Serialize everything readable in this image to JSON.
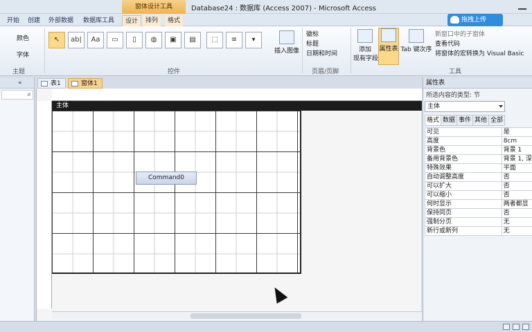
{
  "title": {
    "context_header": "窗体设计工具",
    "window_title": "Database24 : 数据库 (Access 2007) - Microsoft Access"
  },
  "tabs": {
    "items": [
      "开始",
      "创建",
      "外部数据",
      "数据库工具",
      "设计",
      "排列",
      "格式"
    ],
    "active": "设计"
  },
  "cloud_button": {
    "label": "拖拽上传"
  },
  "ribbon": {
    "left_labels": {
      "themes": "主题",
      "colors": "颜色",
      "fonts": "字体"
    },
    "controls_group_label": "控件",
    "header_footer": {
      "logo": "徽标",
      "title": "标题",
      "datetime": "日期和时间",
      "group_label": "页眉/页脚"
    },
    "insert_image": "插入图像",
    "tools": {
      "add_fields": "添加\n现有字段",
      "property_sheet": "属性表",
      "tab_order": "Tab 键次序",
      "subform": "新窗口中的子窗体",
      "view_code": "查看代码",
      "convert_macros": "将窗体的宏转换为 Visual Basic",
      "group_label": "工具"
    }
  },
  "nav": {
    "search_icon": "search-icon"
  },
  "doc_tabs": [
    {
      "label": "表1",
      "active": false
    },
    {
      "label": "窗体1",
      "active": true
    }
  ],
  "design": {
    "section_label": "主体",
    "button_label": "Command0"
  },
  "property_sheet": {
    "title": "属性表",
    "selection_type_label": "所选内容的类型: 节",
    "selected_object": "主体",
    "tabs": [
      "格式",
      "数据",
      "事件",
      "其他",
      "全部"
    ],
    "active_tab": "格式",
    "rows": [
      {
        "key": "可见",
        "value": "是"
      },
      {
        "key": "高度",
        "value": "8cm"
      },
      {
        "key": "背景色",
        "value": "背景 1"
      },
      {
        "key": "备用背景色",
        "value": "背景 1, 深"
      },
      {
        "key": "特殊效果",
        "value": "平面"
      },
      {
        "key": "自动调整高度",
        "value": "否"
      },
      {
        "key": "可以扩大",
        "value": "否"
      },
      {
        "key": "可以缩小",
        "value": "否"
      },
      {
        "key": "何时显示",
        "value": "两者都显"
      },
      {
        "key": "保持同页",
        "value": "否"
      },
      {
        "key": "强制分页",
        "value": "无"
      },
      {
        "key": "新行或新列",
        "value": "无"
      }
    ]
  }
}
